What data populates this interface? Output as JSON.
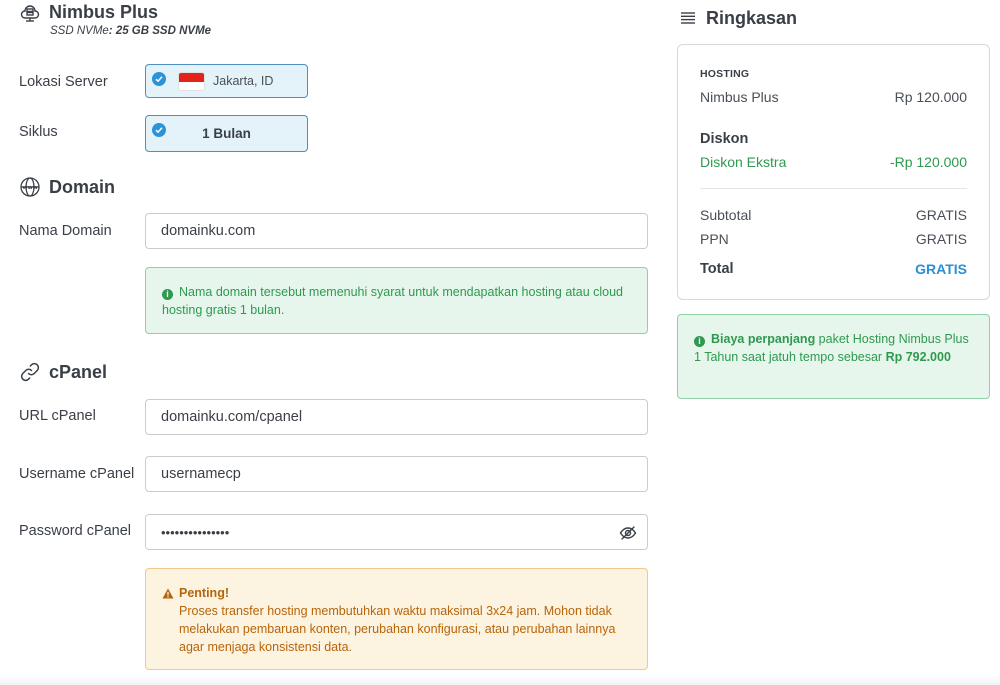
{
  "product": {
    "title": "Nimbus Plus",
    "subtitle_label": "SSD NVMe",
    "subtitle_value": ": 25 GB SSD NVMe"
  },
  "location": {
    "label": "Lokasi Server",
    "value": "Jakarta, ID"
  },
  "cycle": {
    "label": "Siklus",
    "value": "1 Bulan"
  },
  "domain_section": {
    "title": "Domain",
    "field_label": "Nama Domain",
    "field_value": "domainku.com",
    "notice": "Nama domain tersebut memenuhi syarat untuk mendapatkan hosting atau cloud hosting gratis 1 bulan."
  },
  "cpanel_section": {
    "title": "cPanel",
    "url_label": "URL cPanel",
    "url_value": "domainku.com/cpanel",
    "username_label": "Username cPanel",
    "username_value": "usernamecp",
    "password_label": "Password cPanel",
    "password_value": "•••••••••••••••",
    "warning_title": "Penting!",
    "warning_text": "Proses transfer hosting membutuhkan waktu maksimal 3x24 jam. Mohon tidak melakukan pembaruan konten, perubahan konfigurasi, atau perubahan lainnya agar menjaga konsistensi data."
  },
  "summary": {
    "title": "Ringkasan",
    "hosting_header": "HOSTING",
    "item_name": "Nimbus Plus",
    "item_price": "Rp 120.000",
    "discount_header": "Diskon",
    "discount_name": "Diskon Ekstra",
    "discount_value": "-Rp 120.000",
    "subtotal_label": "Subtotal",
    "subtotal_value": "GRATIS",
    "tax_label": "PPN",
    "tax_value": "GRATIS",
    "total_label": "Total",
    "total_value": "GRATIS"
  },
  "renewal": {
    "bold_lead": "Biaya perpanjang",
    "text": " paket Hosting Nimbus Plus 1 Tahun saat jatuh tempo sebesar ",
    "amount": "Rp 792.000"
  },
  "colors": {
    "accent_blue": "#2b8fd6",
    "success_green": "#2e9a4f",
    "warning_orange": "#b7650b"
  },
  "icons": [
    "server-icon",
    "globe-icon",
    "link-icon",
    "list-icon",
    "check-icon",
    "eye-off-icon",
    "info-icon",
    "warning-icon"
  ]
}
